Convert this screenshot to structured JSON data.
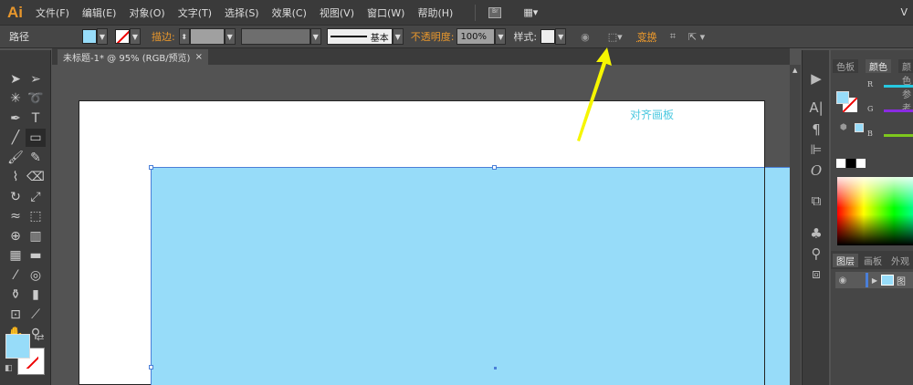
{
  "app": {
    "logo": "Ai",
    "menus": [
      "文件(F)",
      "编辑(E)",
      "对象(O)",
      "文字(T)",
      "选择(S)",
      "效果(C)",
      "视图(V)",
      "窗口(W)",
      "帮助(H)"
    ],
    "bridge_label": "Br",
    "right_label": "V"
  },
  "control": {
    "selection": "路径",
    "fill_color": "#97dcf9",
    "stroke_label": "描边:",
    "brush_label": "基本",
    "opacity_label": "不透明度:",
    "opacity_value": "100%",
    "style_label": "样式:",
    "transform_label": "变换"
  },
  "document": {
    "tab_title": "未标题-1* @ 95% (RGB/预览)",
    "close": "×"
  },
  "canvas": {
    "rect_fill": "#97dcf9",
    "annotation": "对齐画板",
    "arrow_color": "#f6f600"
  },
  "tools": [
    "selection-tool",
    "direct-selection-tool",
    "magic-wand-tool",
    "lasso-tool",
    "pen-tool",
    "type-tool",
    "line-tool",
    "rectangle-tool",
    "paintbrush-tool",
    "pencil-tool",
    "blob-brush-tool",
    "eraser-tool",
    "rotate-tool",
    "scale-tool",
    "warp-tool",
    "free-transform-tool",
    "shape-builder-tool",
    "perspective-grid-tool",
    "mesh-tool",
    "gradient-tool",
    "eyedropper-tool",
    "blend-tool",
    "symbol-sprayer-tool",
    "column-graph-tool",
    "artboard-tool",
    "slice-tool",
    "hand-tool",
    "zoom-tool"
  ],
  "panel": {
    "tabs": [
      "色板",
      "颜色",
      "颜色参考"
    ],
    "channels": [
      "R",
      "G",
      "B"
    ],
    "channel_colors": [
      "#27c8e0",
      "#8a2be2",
      "#7ec81d"
    ],
    "layer_tabs": [
      "图层",
      "画板",
      "外观"
    ],
    "layer_name": "图"
  }
}
